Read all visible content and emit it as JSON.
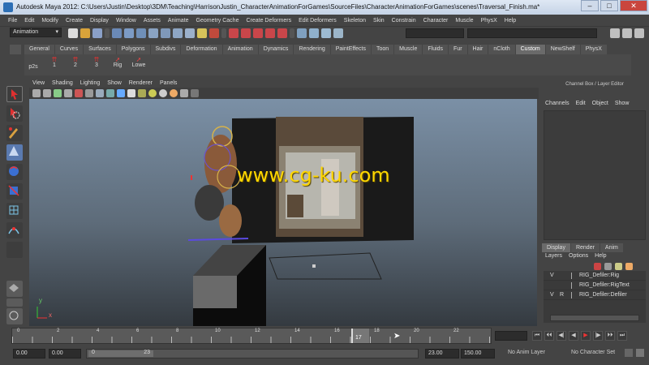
{
  "window": {
    "title": "Autodesk Maya 2012: C:\\Users\\Justin\\Desktop\\3DM\\Teaching\\HarrisonJustin_CharacterAnimationForGames\\SourceFiles\\CharacterAnimationForGames\\scenes\\Traversal_Finish.ma*",
    "minimize": "–",
    "maximize": "□",
    "close": "✕"
  },
  "menu": [
    "File",
    "Edit",
    "Modify",
    "Create",
    "Display",
    "Window",
    "Assets",
    "Animate",
    "Geometry Cache",
    "Create Deformers",
    "Edit Deformers",
    "Skeleton",
    "Skin",
    "Constrain",
    "Character",
    "Muscle",
    "PhysX",
    "Help"
  ],
  "mode_select": "Animation",
  "shelf_tabs": [
    "General",
    "Curves",
    "Surfaces",
    "Polygons",
    "Subdivs",
    "Deformation",
    "Animation",
    "Dynamics",
    "Rendering",
    "PaintEffects",
    "Toon",
    "Muscle",
    "Fluids",
    "Fur",
    "Hair",
    "nCloth",
    "Custom",
    "NewShelf",
    "PhysX"
  ],
  "shelf_active": "Custom",
  "shelf_buttons": [
    "p2s",
    "1",
    "2",
    "3",
    "Rig",
    "Lowe"
  ],
  "viewport_menu": [
    "View",
    "Shading",
    "Lighting",
    "Show",
    "Renderer",
    "Panels"
  ],
  "watermark": "www.cg-ku.com",
  "axis": {
    "y": "y",
    "x": "x"
  },
  "right_panel": {
    "title": "Channel Box / Layer Editor",
    "menu": [
      "Channels",
      "Edit",
      "Object",
      "Show"
    ],
    "layer_tabs": [
      "Display",
      "Render",
      "Anim"
    ],
    "layer_menu": [
      "Layers",
      "Options",
      "Help"
    ],
    "layers": [
      {
        "v": "V",
        "r": "",
        "name": "RIG_Defiler:Rig"
      },
      {
        "v": "",
        "r": "",
        "name": "RIG_Defiler:RigText"
      },
      {
        "v": "V",
        "r": "R",
        "name": "RIG_Defiler:Defiler"
      }
    ]
  },
  "timeline": {
    "ticks": [
      "0",
      "2",
      "4",
      "6",
      "8",
      "10",
      "12",
      "14",
      "16",
      "18",
      "20",
      "22"
    ],
    "current": "17"
  },
  "range": {
    "start": "0.00",
    "playback_start": "0.00",
    "range_start": "0",
    "range_end": "23",
    "playback_end": "23.00",
    "end": "150.00",
    "anim_layer": "No Anim Layer",
    "character_set": "No Character Set"
  },
  "playback_buttons": [
    "⏮",
    "⏴⏴",
    "◀|",
    "◀",
    "▶",
    "|▶",
    "⏵⏵",
    "⏭"
  ]
}
